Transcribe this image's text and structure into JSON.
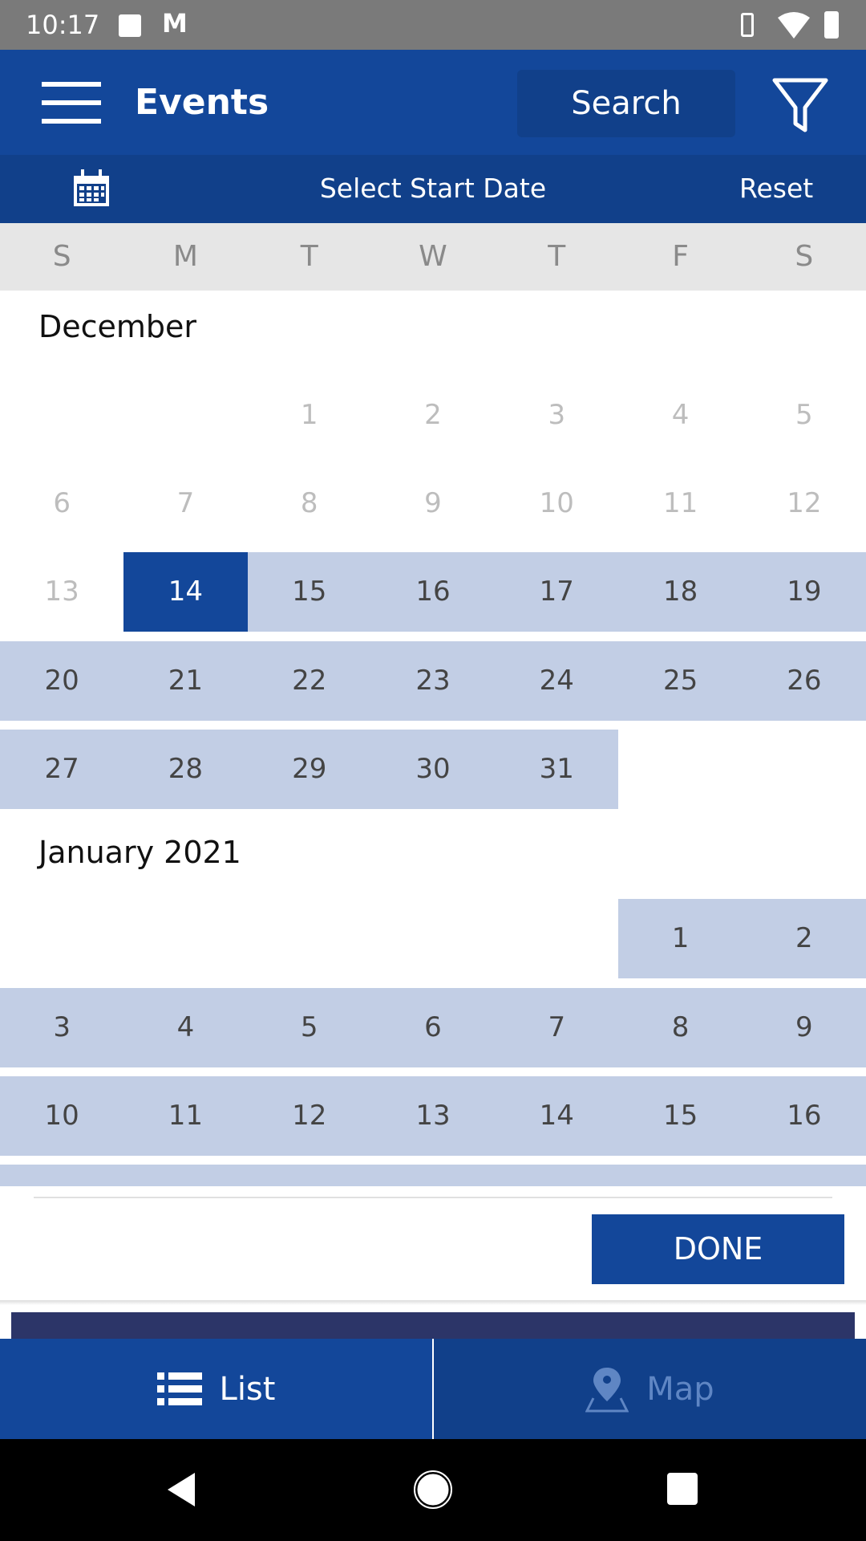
{
  "status_bar": {
    "time": "10:17",
    "icons": [
      "image-icon",
      "gmail-icon",
      "vibrate-icon",
      "wifi-icon",
      "battery-charging-icon"
    ]
  },
  "app_bar": {
    "title": "Events",
    "search_label": "Search",
    "menu_icon": "hamburger-icon",
    "filter_icon": "filter-icon"
  },
  "date_bar": {
    "label": "Select Start Date",
    "reset_label": "Reset",
    "calendar_icon": "calendar-icon"
  },
  "weekdays": [
    "S",
    "M",
    "T",
    "W",
    "T",
    "F",
    "S"
  ],
  "calendar": {
    "selected_day": "14",
    "months": [
      {
        "name": "December",
        "weeks": [
          [
            null,
            null,
            "1",
            "2",
            "3",
            "4",
            "5"
          ],
          [
            "6",
            "7",
            "8",
            "9",
            "10",
            "11",
            "12"
          ],
          [
            "13",
            "14",
            "15",
            "16",
            "17",
            "18",
            "19"
          ],
          [
            "20",
            "21",
            "22",
            "23",
            "24",
            "25",
            "26"
          ],
          [
            "27",
            "28",
            "29",
            "30",
            "31",
            null,
            null
          ]
        ]
      },
      {
        "name": "January 2021",
        "weeks": [
          [
            null,
            null,
            null,
            null,
            null,
            "1",
            "2"
          ],
          [
            "3",
            "4",
            "5",
            "6",
            "7",
            "8",
            "9"
          ],
          [
            "10",
            "11",
            "12",
            "13",
            "14",
            "15",
            "16"
          ]
        ]
      }
    ]
  },
  "done_label": "DONE",
  "tabs": [
    {
      "label": "List",
      "icon": "list-icon",
      "active": true
    },
    {
      "label": "Map",
      "icon": "map-pin-icon",
      "active": false
    }
  ],
  "colors": {
    "primary": "#13479a",
    "range": "#c2cee5",
    "disabled": "#bdbdbd"
  }
}
